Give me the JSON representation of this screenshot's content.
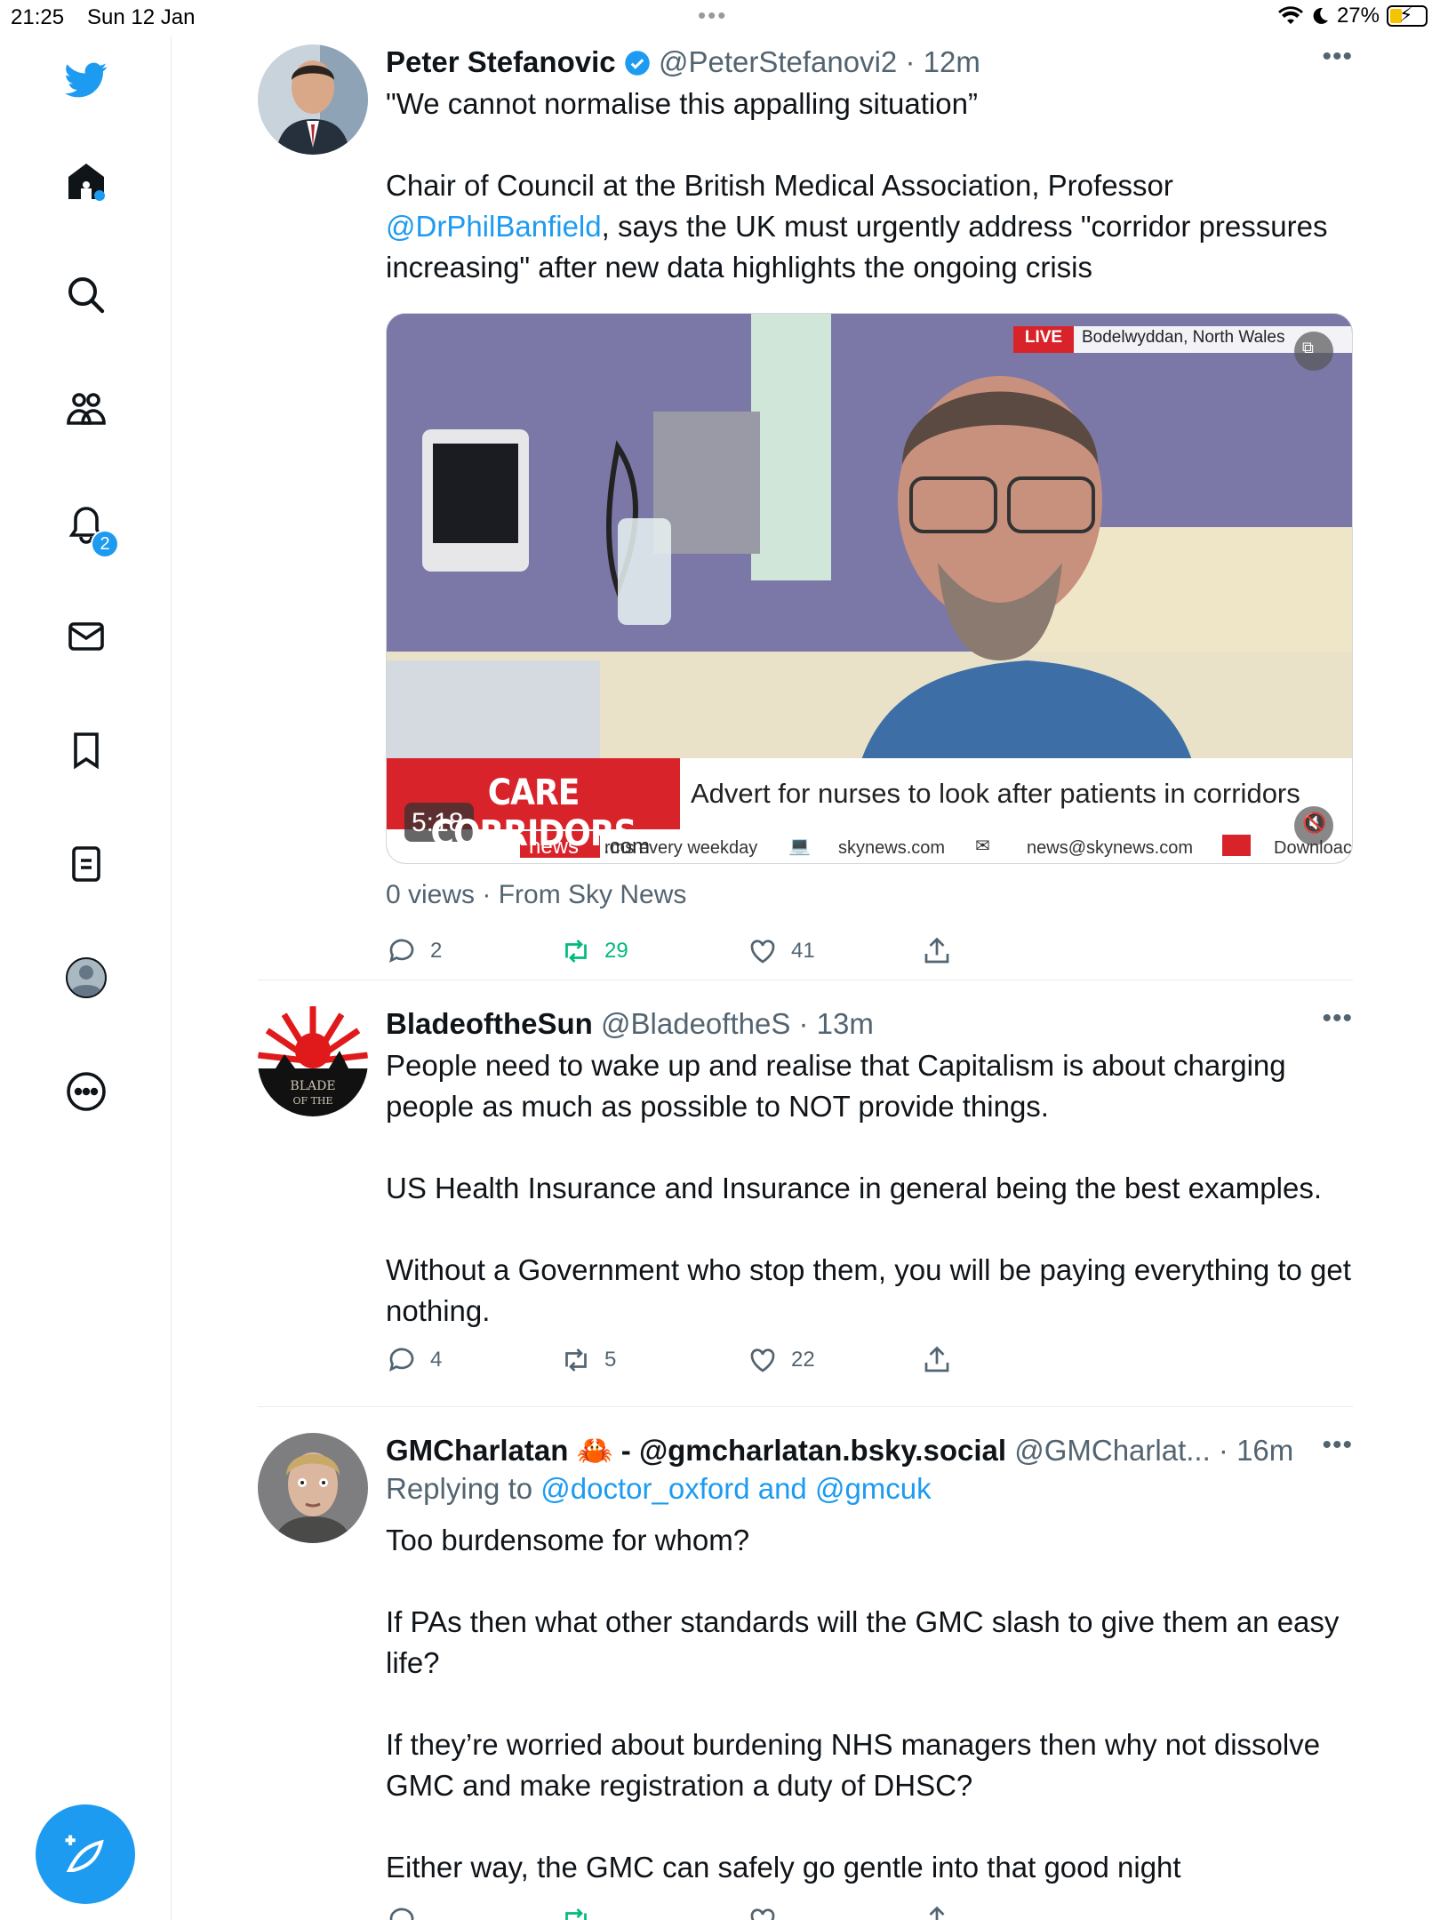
{
  "status_bar": {
    "time": "21:25",
    "date": "Sun 12 Jan",
    "battery": "27%"
  },
  "sidebar": {
    "notifications_badge": "2"
  },
  "tweets": [
    {
      "name": "Peter Stefanovic",
      "handle": "@PeterStefanovi2",
      "age": "· 12m",
      "text_line1": "\"We cannot normalise this appalling situation”",
      "text_p2_a": "Chair of Council at the British Medical Association, Professor ",
      "text_p2_link": "@DrPhilBanfield",
      "text_p2_b": ", says the UK must urgently address \"corridor pressures increasing\" after new data highlights the ongoing crisis",
      "video": {
        "live": "LIVE",
        "location": "Bodelwyddan, North Wales",
        "headline_tag": "CARE CORRIDORS",
        "headline": "Advert for nurses to look after patients in corridors",
        "ticker_brand": "news",
        "ticker_dotcom": ".com",
        "ticker_1": "rms every weekday",
        "ticker_2": "skynews.com",
        "ticker_3": "news@skynews.com",
        "ticker_4": "Downloac",
        "duration": "5:18"
      },
      "views": "0 views · From Sky News",
      "replies": "2",
      "retweets": "29",
      "likes": "41"
    },
    {
      "name": "BladeoftheSun",
      "handle": "@BladeoftheS",
      "age": "· 13m",
      "text": "People need to wake up and realise that Capitalism is about charging people as much as possible to NOT provide things.\n\nUS Health Insurance and Insurance in general being the best examples.\n\nWithout a Government who stop them, you will be paying everything to get nothing.",
      "avatar_text": "BLADE OF THE",
      "replies": "4",
      "retweets": "5",
      "likes": "22"
    },
    {
      "name": "GMCharlatan",
      "name_suffix": " - @gmcharlatan.bsky.social",
      "handle": "@GMCharlat...",
      "age": "· 16m",
      "replying_prefix": "Replying to ",
      "replying_to": "@doctor_oxford and @gmcuk",
      "text": "Too burdensome for whom?\n\nIf PAs then what other standards will the GMC slash to give them an easy life?\n\nIf they’re worried about burdening NHS managers then why not dissolve GMC and make registration a duty of DHSC?\n\nEither way, the GMC can safely go gentle into that good night"
    }
  ]
}
